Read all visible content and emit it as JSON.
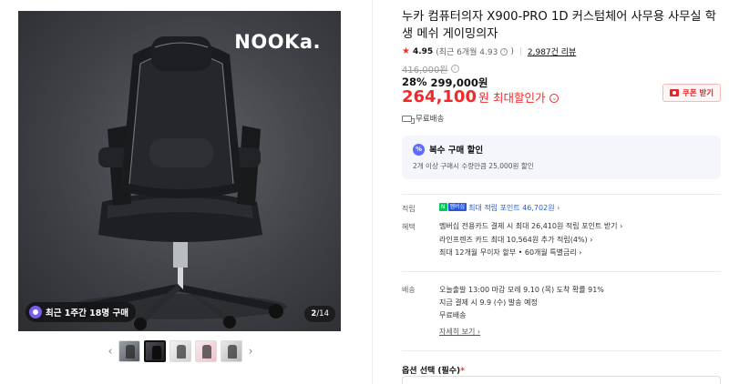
{
  "gallery": {
    "brand": "NOOKa.",
    "recent_badge": "최근 1주간 18명 구매",
    "page_current": "2",
    "page_total": "/14",
    "prev_arrow": "‹",
    "next_arrow": "›"
  },
  "product": {
    "title": "누카 컴퓨터의자 X900-PRO 1D 커스텀체어 사무용 사무실 학생 메쉬 게이밍의자",
    "rating_score": "4.95",
    "rating_recent": "(최근 6개월 4.93",
    "rating_recent_close": ")",
    "review_count": "2,987건 리뷰",
    "original_price": "416,000원",
    "discount_rate": "28%",
    "sale_price": "299,000원",
    "final_price": "264,100",
    "final_won": "원",
    "final_label": "최대할인가",
    "coupon_label": "쿠폰 받기",
    "shipping": "무료배송"
  },
  "multi_purchase": {
    "title": "복수 구매 할인",
    "icon_text": "%",
    "description": "2개 이상 구매시 수량만큼 25,000원 할인"
  },
  "points": {
    "label": "적립",
    "badge_n": "N",
    "badge_m": "멤버십",
    "text": "최대 적립 포인트 46,702원 ›"
  },
  "benefits": {
    "label": "혜택",
    "items": [
      "멤버십 전용카드 결제 시 최대 26,410원 적립 포인트 받기 ›",
      "라인프렌즈 카드 최대 10,564원 추가 적립(4%) ›",
      "최대 12개월 무이자 할부 • 60개월 특별금리 ›"
    ]
  },
  "delivery": {
    "label": "배송",
    "line1": "오늘출발 13:00 마감  모레 9.10 (목) 도착 확률 91%",
    "line2": "지금 결제 시 9.9 (수) 발송 예정",
    "line3": "무료배송",
    "detail_link": "자세히 보기 ›"
  },
  "option": {
    "label": "옵션 선택 (필수)",
    "required_mark": "*"
  },
  "colors": {
    "accent_red": "#f02a2a",
    "points_blue": "#2a5bd7",
    "naver_green": "#03c75a"
  }
}
